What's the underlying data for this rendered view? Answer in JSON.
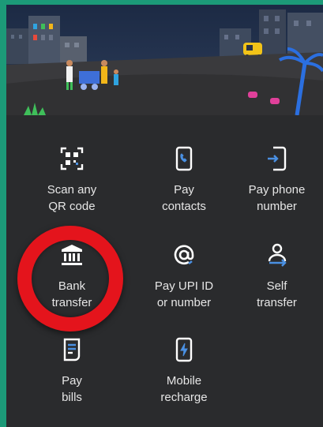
{
  "accent_color": "#1c9a78",
  "highlight_color": "#e4141c",
  "tiles": [
    {
      "label": "Scan any\nQR code",
      "icon": "qr-scan-icon"
    },
    {
      "label": "Pay\ncontacts",
      "icon": "phone-contacts-icon"
    },
    {
      "label": "Pay phone\nnumber",
      "icon": "phone-pay-icon"
    },
    {
      "label": "Bank\ntransfer",
      "icon": "bank-icon"
    },
    {
      "label": "Pay UPI ID\nor number",
      "icon": "at-sign-icon"
    },
    {
      "label": "Self\ntransfer",
      "icon": "self-transfer-icon"
    },
    {
      "label": "Pay\nbills",
      "icon": "bill-icon"
    },
    {
      "label": "Mobile\nrecharge",
      "icon": "mobile-recharge-icon"
    }
  ]
}
